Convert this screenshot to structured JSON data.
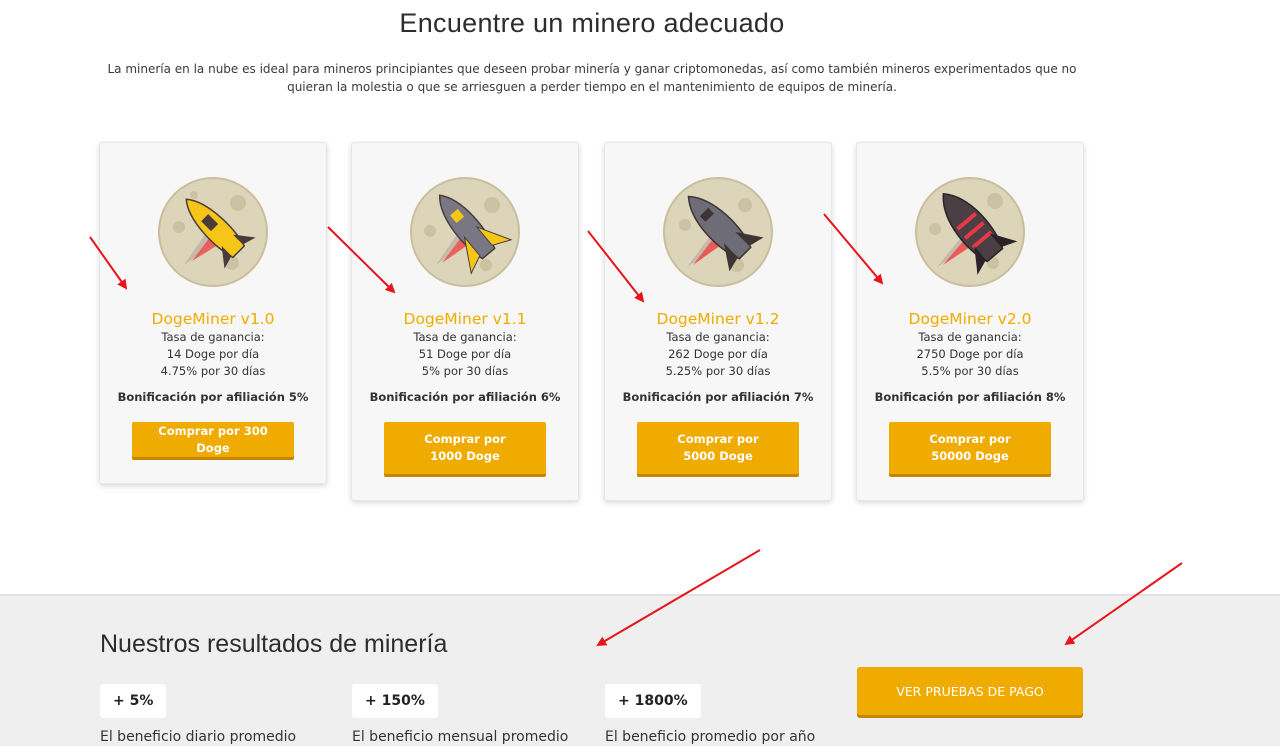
{
  "header": {
    "title": "Encuentre un minero adecuado",
    "intro": "La minería en la nube es ideal para mineros principiantes que deseen probar minería y ganar criptomonedas, así como también mineros experimentados que no quieran la molestia o que se arriesguen a perder tiempo en el mantenimiento de equipos de minería."
  },
  "miners": [
    {
      "name": "DogeMiner v1.0",
      "rate_label": "Tasa de ganancia:",
      "per_day": "14 Doge por día",
      "per_month": "4.75% por 30 días",
      "bonus": "Bonificación por afiliación 5%",
      "buy_label": "Comprar por 300 Doge",
      "icon": "rocket-yellow-icon"
    },
    {
      "name": "DogeMiner v1.1",
      "rate_label": "Tasa de ganancia:",
      "per_day": "51 Doge por día",
      "per_month": "5% por 30 días",
      "bonus": "Bonificación por afiliación 6%",
      "buy_label": "Comprar por 1000 Doge",
      "icon": "rocket-gray-yellow-icon"
    },
    {
      "name": "DogeMiner v1.2",
      "rate_label": "Tasa de ganancia:",
      "per_day": "262 Doge por día",
      "per_month": "5.25% por 30 días",
      "bonus": "Bonificación por afiliación 7%",
      "buy_label": "Comprar por 5000 Doge",
      "icon": "rocket-gray-icon"
    },
    {
      "name": "DogeMiner v2.0",
      "rate_label": "Tasa de ganancia:",
      "per_day": "2750 Doge por día",
      "per_month": "5.5% por 30 días",
      "bonus": "Bonificación por afiliación 8%",
      "buy_label": "Comprar por 50000 Doge",
      "icon": "rocket-dark-red-icon"
    }
  ],
  "results": {
    "title": "Nuestros resultados de minería",
    "stats": [
      {
        "value": "+ 5%",
        "label": "El beneficio diario promedio"
      },
      {
        "value": "+ 150%",
        "label": "El beneficio mensual promedio"
      },
      {
        "value": "+ 1800%",
        "label": "El beneficio promedio por año"
      }
    ],
    "proof_button": "VER PRUEBAS DE PAGO"
  },
  "colors": {
    "accent": "#f0ab00",
    "annotation": "#e8141b",
    "section_bg": "#efefef"
  }
}
